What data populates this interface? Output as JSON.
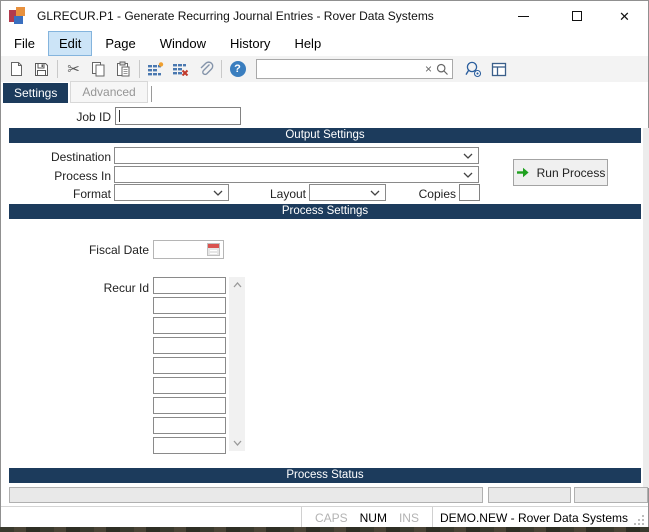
{
  "window": {
    "title": "GLRECUR.P1 - Generate Recurring Journal Entries - Rover Data Systems"
  },
  "icons": {
    "cut_glyph": "✂",
    "help_glyph": "?",
    "search_clear_glyph": "×",
    "close_glyph": "✕"
  },
  "menu": {
    "items": [
      {
        "label": "File",
        "active": false
      },
      {
        "label": "Edit",
        "active": true
      },
      {
        "label": "Page",
        "active": false
      },
      {
        "label": "Window",
        "active": false
      },
      {
        "label": "History",
        "active": false
      },
      {
        "label": "Help",
        "active": false
      }
    ]
  },
  "toolbar": {
    "search": {
      "value": "",
      "placeholder": ""
    }
  },
  "tabs": [
    {
      "label": "Settings",
      "active": true
    },
    {
      "label": "Advanced",
      "active": false
    }
  ],
  "form": {
    "job_id": {
      "label": "Job ID",
      "value": ""
    },
    "output_section": {
      "title": "Output Settings",
      "destination": {
        "label": "Destination",
        "value": ""
      },
      "process_in": {
        "label": "Process In",
        "value": ""
      },
      "format": {
        "label": "Format",
        "value": ""
      },
      "layout": {
        "label": "Layout",
        "value": ""
      },
      "copies": {
        "label": "Copies",
        "value": ""
      },
      "run_button": {
        "label": "Run Process"
      }
    },
    "process_section": {
      "title": "Process Settings",
      "fiscal_date": {
        "label": "Fiscal Date",
        "value": ""
      },
      "recur_id": {
        "label": "Recur Id",
        "rows": 9,
        "values": [
          "",
          "",
          "",
          "",
          "",
          "",
          "",
          "",
          ""
        ]
      }
    },
    "status_section": {
      "title": "Process Status",
      "fields": [
        "",
        "",
        ""
      ]
    }
  },
  "status_bar": {
    "caps": {
      "label": "CAPS",
      "active": false
    },
    "num": {
      "label": "NUM",
      "active": true
    },
    "ins": {
      "label": "INS",
      "active": false
    },
    "session": "DEMO.NEW - Rover Data Systems"
  },
  "colors": {
    "header_navy": "#1c3b5c",
    "menu_highlight": "#cce4f7",
    "menu_highlight_border": "#84b4dd",
    "accent_blue": "#2c5f9e",
    "run_arrow_green": "#1fa11f",
    "calendar_red": "#d9534f",
    "insert_orange": "#f0a030",
    "delete_red": "#c0392b"
  }
}
